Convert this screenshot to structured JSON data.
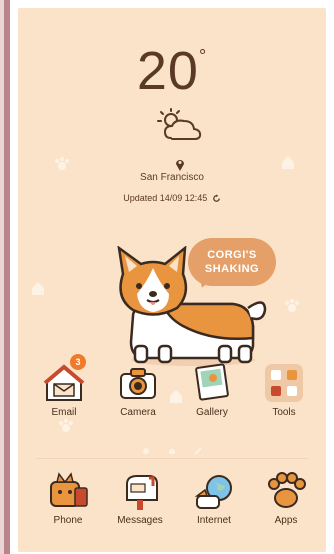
{
  "clock": {
    "time": "20",
    "symbol": "°"
  },
  "weather": {
    "icon": "sun-cloud-icon",
    "city": "San Francisco",
    "updated": "Updated 14/09 12:45"
  },
  "widget": {
    "bubble_line1": "CORGI'S",
    "bubble_line2": "SHAKING"
  },
  "home_apps": [
    {
      "label": "Email",
      "icon": "email-house-icon",
      "badge": "3"
    },
    {
      "label": "Camera",
      "icon": "camera-icon"
    },
    {
      "label": "Gallery",
      "icon": "gallery-icon"
    },
    {
      "label": "Tools",
      "icon": "tools-folder-icon"
    }
  ],
  "dock_apps": [
    {
      "label": "Phone",
      "icon": "phone-corgi-icon"
    },
    {
      "label": "Messages",
      "icon": "messages-mailbox-icon"
    },
    {
      "label": "Internet",
      "icon": "internet-globe-icon"
    },
    {
      "label": "Apps",
      "icon": "paw-apps-icon"
    }
  ],
  "colors": {
    "background": "#fbe3c9",
    "accent": "#e5a06a",
    "badge": "#f07a2a",
    "text": "#5a3a26"
  }
}
